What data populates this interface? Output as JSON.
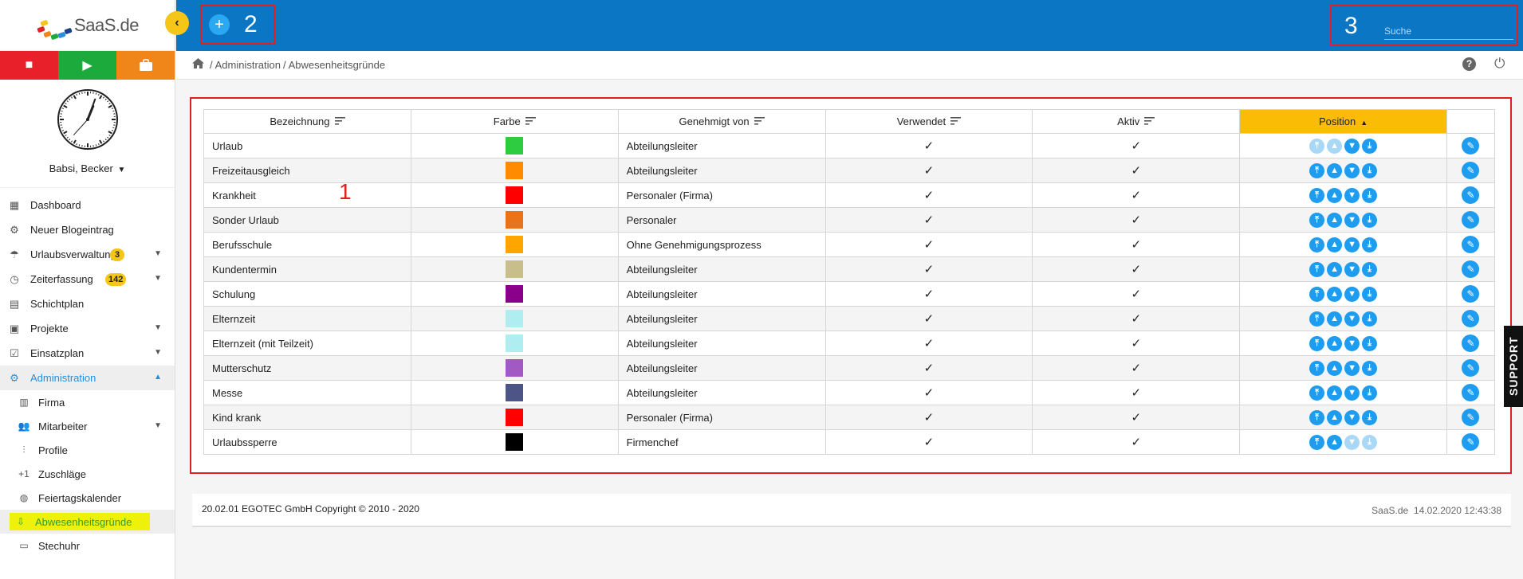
{
  "logo": {
    "text": "SaaS.de"
  },
  "sidebar": {
    "control_colors": {
      "stop": "#e8202a",
      "play": "#1daa3d",
      "case": "#f08519"
    },
    "user": {
      "name": "Babsi, Becker"
    },
    "nav": [
      {
        "label": "Dashboard",
        "icon": "dashboard-icon"
      },
      {
        "label": "Neuer Blogeintrag",
        "icon": "blog-icon"
      },
      {
        "label": "Urlaubsverwaltung",
        "icon": "vacation-icon",
        "badge": "3",
        "chevron": "down"
      },
      {
        "label": "Zeiterfassung",
        "icon": "clock-icon",
        "badge": "142",
        "chevron": "down"
      },
      {
        "label": "Schichtplan",
        "icon": "clipboard-icon"
      },
      {
        "label": "Projekte",
        "icon": "project-icon",
        "chevron": "down"
      },
      {
        "label": "Einsatzplan",
        "icon": "checklist-icon",
        "chevron": "down"
      },
      {
        "label": "Administration",
        "icon": "gear-icon",
        "chevron": "up"
      }
    ],
    "admin_sub": [
      {
        "label": "Firma",
        "icon": "building-icon"
      },
      {
        "label": "Mitarbeiter",
        "icon": "people-icon",
        "chevron": "down"
      },
      {
        "label": "Profile",
        "icon": "sliders-icon"
      },
      {
        "label": "Zuschläge",
        "icon": "plus-one-icon"
      },
      {
        "label": "Feiertagskalender",
        "icon": "globe-icon"
      },
      {
        "label": "Abwesenheitsgründe",
        "icon": "download-icon"
      },
      {
        "label": "Stechuhr",
        "icon": "terminal-icon"
      }
    ]
  },
  "header": {
    "annotation_add": "2",
    "annotation_search": "3",
    "search_placeholder": "Suche"
  },
  "breadcrumb": {
    "items": [
      "Administration",
      "Abwesenheitsgründe"
    ]
  },
  "table": {
    "annotation": "1",
    "columns": [
      {
        "label": "Bezeichnung"
      },
      {
        "label": "Farbe"
      },
      {
        "label": "Genehmigt von"
      },
      {
        "label": "Verwendet"
      },
      {
        "label": "Aktiv"
      },
      {
        "label": "Position",
        "sorted": "asc"
      },
      {
        "label": ""
      }
    ],
    "rows": [
      {
        "name": "Urlaub",
        "color": "#2ecc40",
        "approver": "Abteilungsleiter",
        "used": true,
        "active": true,
        "pos": [
          false,
          false,
          true,
          true
        ]
      },
      {
        "name": "Freizeitausgleich",
        "color": "#ff8c00",
        "approver": "Abteilungsleiter",
        "used": true,
        "active": true,
        "pos": [
          true,
          true,
          true,
          true
        ]
      },
      {
        "name": "Krankheit",
        "color": "#ff0000",
        "approver": "Personaler (Firma)",
        "used": true,
        "active": true,
        "pos": [
          true,
          true,
          true,
          true
        ]
      },
      {
        "name": "Sonder Urlaub",
        "color": "#e8731a",
        "approver": "Personaler",
        "used": true,
        "active": true,
        "pos": [
          true,
          true,
          true,
          true
        ]
      },
      {
        "name": "Berufsschule",
        "color": "#ffa500",
        "approver": "Ohne Genehmigungsprozess",
        "used": true,
        "active": true,
        "pos": [
          true,
          true,
          true,
          true
        ]
      },
      {
        "name": "Kundentermin",
        "color": "#c8be8a",
        "approver": "Abteilungsleiter",
        "used": true,
        "active": true,
        "pos": [
          true,
          true,
          true,
          true
        ]
      },
      {
        "name": "Schulung",
        "color": "#8b008b",
        "approver": "Abteilungsleiter",
        "used": true,
        "active": true,
        "pos": [
          true,
          true,
          true,
          true
        ]
      },
      {
        "name": "Elternzeit",
        "color": "#aeeef0",
        "approver": "Abteilungsleiter",
        "used": true,
        "active": true,
        "pos": [
          true,
          true,
          true,
          true
        ]
      },
      {
        "name": "Elternzeit (mit Teilzeit)",
        "color": "#aeeef0",
        "approver": "Abteilungsleiter",
        "used": true,
        "active": true,
        "pos": [
          true,
          true,
          true,
          true
        ]
      },
      {
        "name": "Mutterschutz",
        "color": "#a259c4",
        "approver": "Abteilungsleiter",
        "used": true,
        "active": true,
        "pos": [
          true,
          true,
          true,
          true
        ]
      },
      {
        "name": "Messe",
        "color": "#4d5587",
        "approver": "Abteilungsleiter",
        "used": true,
        "active": true,
        "pos": [
          true,
          true,
          true,
          true
        ]
      },
      {
        "name": "Kind krank",
        "color": "#ff0000",
        "approver": "Personaler (Firma)",
        "used": true,
        "active": true,
        "pos": [
          true,
          true,
          true,
          true
        ]
      },
      {
        "name": "Urlaubssperre",
        "color": "#000000",
        "approver": "Firmenchef",
        "used": true,
        "active": true,
        "pos": [
          true,
          true,
          false,
          false
        ]
      }
    ]
  },
  "footer": {
    "copyright": "20.02.01 EGOTEC GmbH Copyright © 2010 - 2020",
    "brand": "SaaS.de",
    "datetime": "14.02.2020 12:43:38"
  },
  "support_label": "SUPPORT"
}
